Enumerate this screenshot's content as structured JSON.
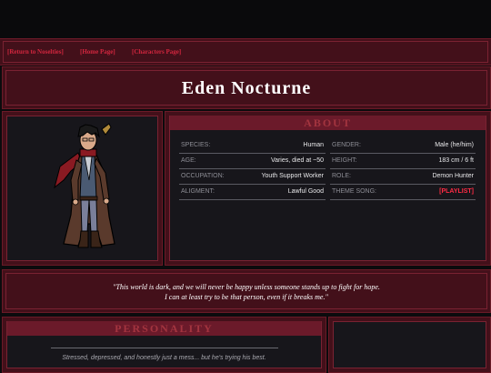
{
  "nav": {
    "links": [
      "[Return to Noselties]",
      "[Home Page]",
      "[Characters Page]"
    ]
  },
  "page": {
    "title": "Eden Nocturne"
  },
  "about": {
    "heading": "ABOUT",
    "rows": [
      {
        "label": "SPECIES:",
        "value": "Human"
      },
      {
        "label": "GENDER:",
        "value": "Male (he/him)"
      },
      {
        "label": "AGE:",
        "value": "Varies, died at ~50"
      },
      {
        "label": "HEIGHT:",
        "value": "183 cm / 6 ft"
      },
      {
        "label": "OCCUPATION:",
        "value": "Youth Support Worker"
      },
      {
        "label": "ROLE:",
        "value": "Demon Hunter"
      },
      {
        "label": "ALIGMENT:",
        "value": "Lawful Good"
      },
      {
        "label": "THEME SONG:",
        "value": "[PLAYLIST]"
      }
    ]
  },
  "quote": {
    "line1": "\"This world is dark, and we will never be happy unless someone stands up to fight for hope.",
    "line2": "I can at least try to be that person, even if it breaks me.\""
  },
  "personality": {
    "heading": "PERSONALITY",
    "text": "Stressed, depressed, and honestly just a mess... but he's trying his best."
  },
  "colors": {
    "accent": "#d2263e",
    "panel": "#43101a",
    "dark": "#17161b"
  }
}
